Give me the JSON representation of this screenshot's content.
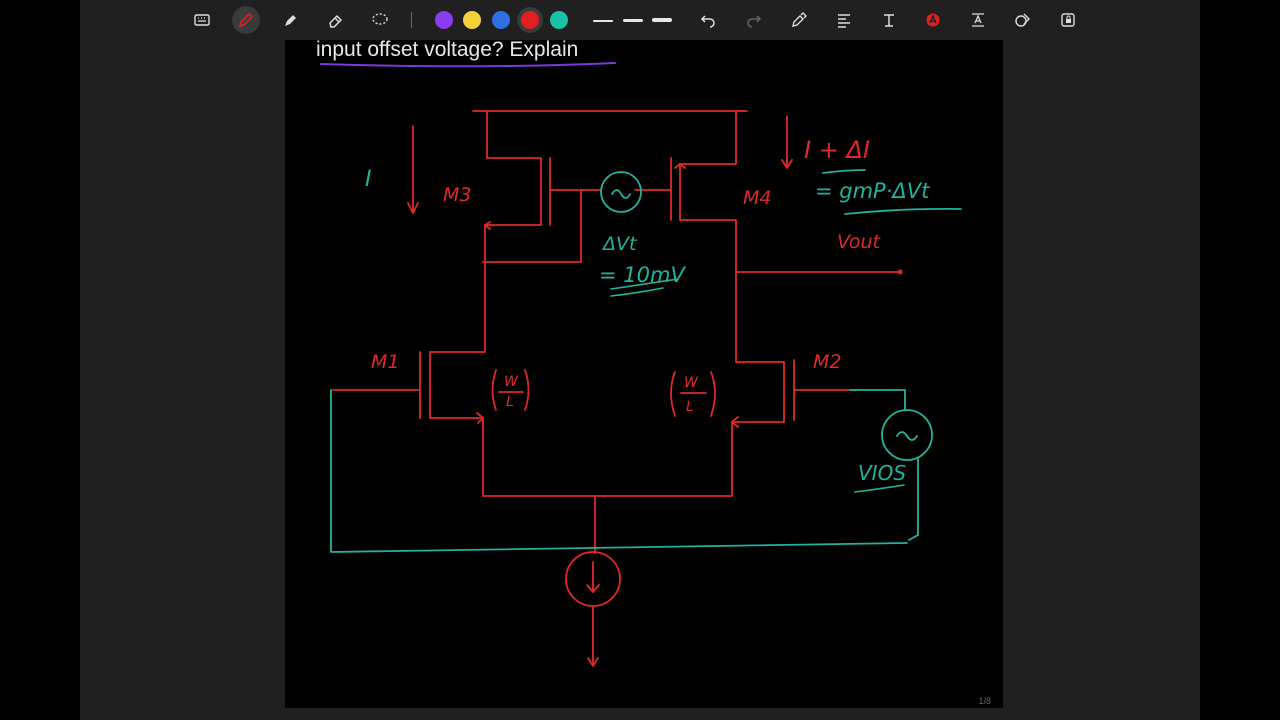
{
  "page": {
    "heading": "input offset voltage? Explain",
    "page_indicator": "1/8"
  },
  "toolbar": {
    "tools": [
      "keyboard-icon",
      "pen-icon",
      "highlighter-icon",
      "eraser-icon",
      "lasso-icon",
      "undo-icon",
      "redo-icon",
      "shape-pen-icon",
      "text-align-icon",
      "handwriting-icon",
      "color-fill-icon",
      "text-box-icon",
      "shapes-icon",
      "lock-icon"
    ],
    "colors": [
      "#8a3cf0",
      "#f5d33a",
      "#2f6fe6",
      "#e02020",
      "#19c2a5"
    ],
    "selected_color": "#e02020"
  },
  "annotations": {
    "current_label": "I",
    "m3": "M3",
    "m4": "M4",
    "m1": "M1",
    "m2": "M2",
    "delta_i": "I + ΔI",
    "gm_eq": "= gmP·ΔVt",
    "vout": "Vout",
    "dvt": "ΔVt",
    "dvt_val": "= 10mV",
    "wl_left_num": "W",
    "wl_left_den": "L",
    "wl_right_num": "W",
    "wl_right_den": "L",
    "vios": "VIOS"
  },
  "ink_colors": {
    "red": "#e02828",
    "teal": "#22b3a0",
    "heading_underline": "#7a3ad8"
  }
}
